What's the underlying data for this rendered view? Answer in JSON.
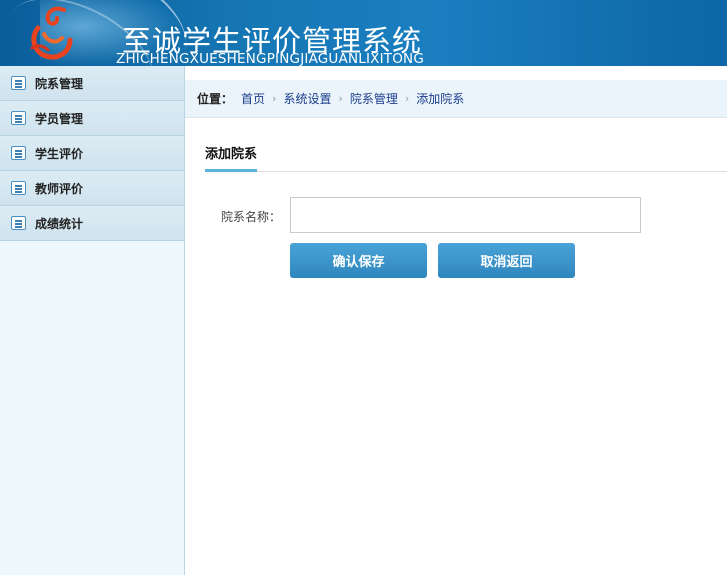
{
  "header": {
    "title_cn": "至诚学生评价管理系统",
    "title_en": "ZHICHENGXUESHENGPINGJIAGUANLIXITONG",
    "logo_icon": "phoenix-logo-icon"
  },
  "sidebar": {
    "items": [
      {
        "label": "院系管理",
        "icon": "list-icon"
      },
      {
        "label": "学员管理",
        "icon": "list-icon"
      },
      {
        "label": "学生评价",
        "icon": "list-icon"
      },
      {
        "label": "教师评价",
        "icon": "list-icon"
      },
      {
        "label": "成绩统计",
        "icon": "list-icon"
      }
    ]
  },
  "breadcrumb": {
    "label": "位置：",
    "items": [
      "首页",
      "系统设置",
      "院系管理",
      "添加院系"
    ],
    "separator": "›"
  },
  "tab": {
    "label": "添加院系"
  },
  "form": {
    "field_label": "院系名称：",
    "field_value": "",
    "field_placeholder": "",
    "save_label": "确认保存",
    "cancel_label": "取消返回"
  },
  "colors": {
    "header_blue": "#1677b5",
    "button_blue": "#3a93c9",
    "tab_underline": "#59b3dc",
    "sidebar_bg": "#eef7fb"
  }
}
